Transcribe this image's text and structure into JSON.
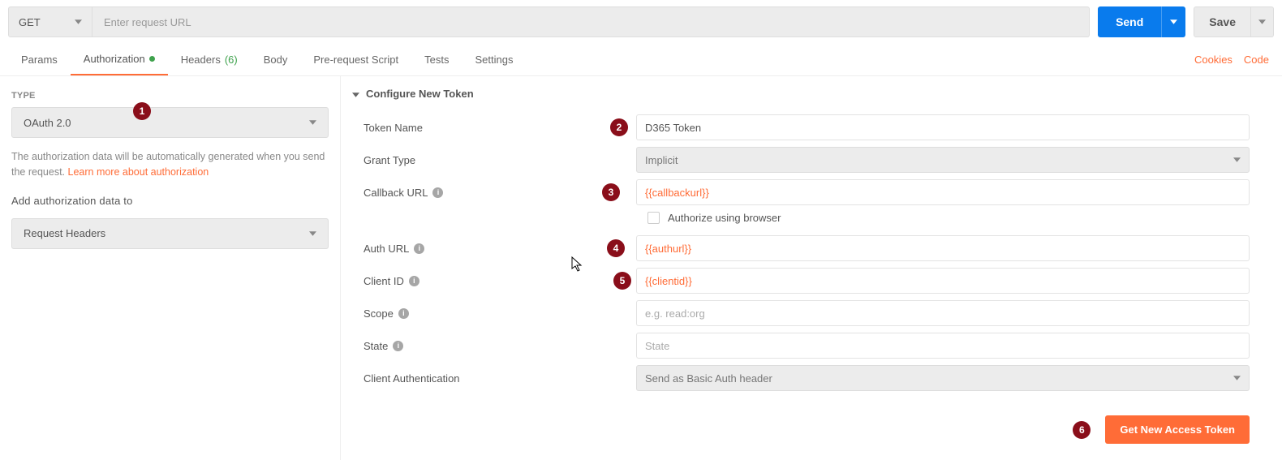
{
  "request": {
    "method": "GET",
    "url_placeholder": "Enter request URL",
    "url": "",
    "send_label": "Send",
    "save_label": "Save"
  },
  "tabs": {
    "params": "Params",
    "authorization": "Authorization",
    "headers": "Headers",
    "headers_count": "(6)",
    "body": "Body",
    "prerequest": "Pre-request Script",
    "tests": "Tests",
    "settings": "Settings",
    "cookies": "Cookies",
    "code": "Code"
  },
  "left": {
    "type_label": "TYPE",
    "type_value": "OAuth 2.0",
    "help_a": "The authorization data will be automatically generated when you send the request. ",
    "help_link": "Learn more about authorization",
    "add_to_label": "Add authorization data to",
    "add_to_value": "Request Headers"
  },
  "right": {
    "section_title": "Configure New Token",
    "rows": {
      "token_name": {
        "label": "Token Name",
        "value": "D365 Token"
      },
      "grant_type": {
        "label": "Grant Type",
        "value": "Implicit"
      },
      "callback_url": {
        "label": "Callback URL",
        "value": "{{callbackurl}}"
      },
      "authorize_browser": {
        "label": "Authorize using browser"
      },
      "auth_url": {
        "label": "Auth URL",
        "value": "{{authurl}}"
      },
      "client_id": {
        "label": "Client ID",
        "value": "{{clientid}}"
      },
      "scope": {
        "label": "Scope",
        "placeholder": "e.g. read:org",
        "value": ""
      },
      "state": {
        "label": "State",
        "placeholder": "State",
        "value": ""
      },
      "client_auth": {
        "label": "Client Authentication",
        "value": "Send as Basic Auth header"
      }
    },
    "get_token_button": "Get New Access Token"
  },
  "annotations": {
    "b1": "1",
    "b2": "2",
    "b3": "3",
    "b4": "4",
    "b5": "5",
    "b6": "6"
  }
}
